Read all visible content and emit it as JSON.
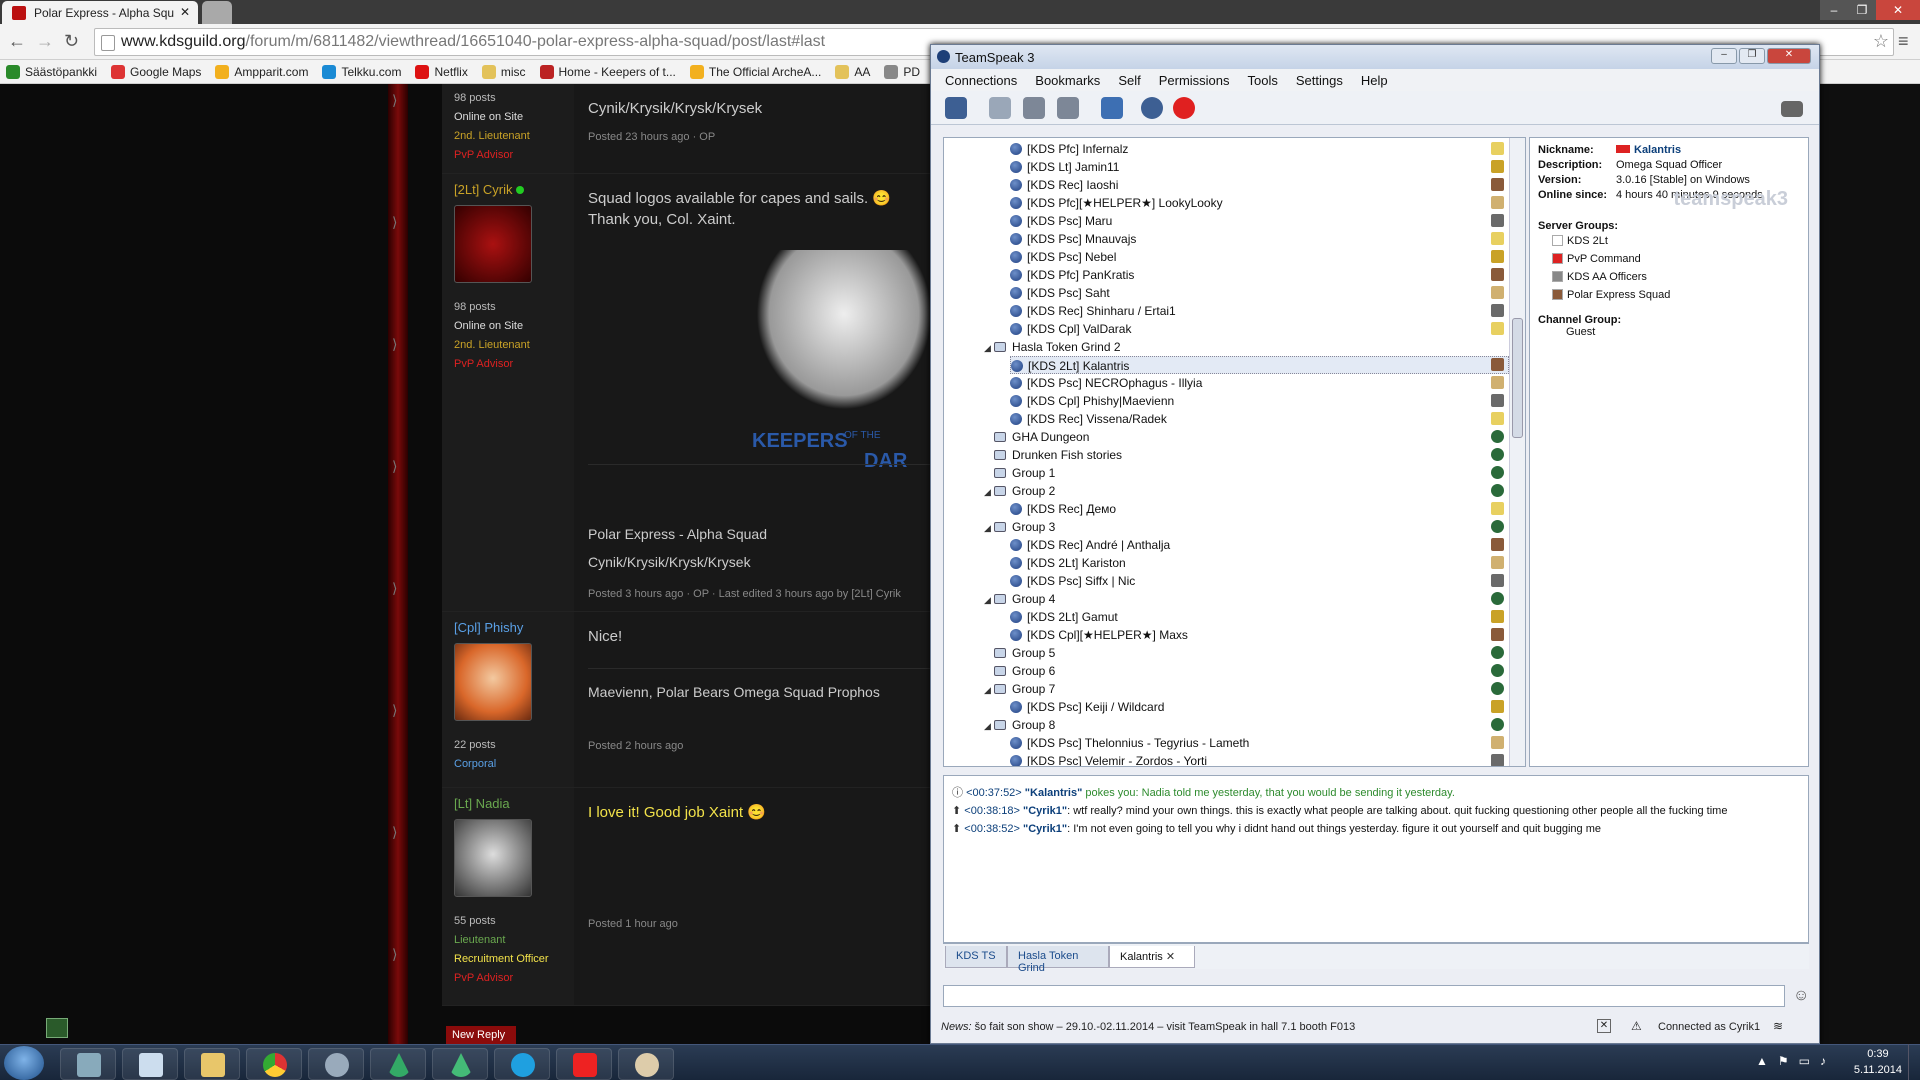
{
  "browser": {
    "tab_title": "Polar Express - Alpha Squ",
    "url_host": "www.kdsguild.org",
    "url_path": "/forum/m/6811482/viewthread/16651040-polar-express-alpha-squad/post/last#last",
    "bookmarks": [
      "Säästöpankki",
      "Google Maps",
      "Ampparit.com",
      "Telkku.com",
      "Netflix",
      "misc",
      "Home - Keepers of t...",
      "The Official ArcheA...",
      "AA",
      "PD"
    ]
  },
  "forum": {
    "post0": {
      "posts": "98 posts",
      "status": "Online on Site",
      "rank": "2nd. Lieutenant",
      "role": "PvP Advisor",
      "text": "Cynik/Krysik/Krysk/Krysek",
      "meta": "Posted 23 hours ago · OP"
    },
    "post1": {
      "name": "[2Lt] Cyrik",
      "posts": "98 posts",
      "status": "Online on Site",
      "rank": "2nd. Lieutenant",
      "role": "PvP Advisor",
      "text1": "Squad logos available for capes and sails. 😊",
      "text2": "Thank you, Col. Xaint.",
      "logo_text1": "KEEPERS",
      "logo_text2": "OF THE",
      "logo_text3": "DAR",
      "text3": "Polar Express - Alpha Squad",
      "text4": "Cynik/Krysik/Krysk/Krysek",
      "meta": "Posted 3 hours ago · OP · Last edited 3 hours ago by [2Lt] Cyrik"
    },
    "post2": {
      "name": "[Cpl] Phishy",
      "posts": "22 posts",
      "rank": "Corporal",
      "text1": "Nice!",
      "text2": "Maevienn, Polar Bears Omega Squad Prophos",
      "meta": "Posted 2 hours ago"
    },
    "post3": {
      "name": "[Lt] Nadia",
      "posts": "55 posts",
      "rank": "Lieutenant",
      "role1": "Recruitment Officer",
      "role2": "PvP Advisor",
      "text": "I love it! Good job Xaint 😊",
      "meta": "Posted 1 hour ago"
    },
    "new_reply": "New Reply"
  },
  "ts": {
    "title": "TeamSpeak 3",
    "menu": [
      "Connections",
      "Bookmarks",
      "Self",
      "Permissions",
      "Tools",
      "Settings",
      "Help"
    ],
    "tree": [
      {
        "t": "u",
        "d": 1,
        "label": "[KDS Pfc] Infernalz"
      },
      {
        "t": "u",
        "d": 1,
        "label": "[KDS Lt] Jamin11"
      },
      {
        "t": "u",
        "d": 1,
        "label": "[KDS Rec] Iaoshi"
      },
      {
        "t": "u",
        "d": 1,
        "label": "[KDS Pfc][★HELPER★] LookyLooky"
      },
      {
        "t": "u",
        "d": 1,
        "label": "[KDS Psc] Maru"
      },
      {
        "t": "u",
        "d": 1,
        "label": "[KDS Psc] Mnauvajs"
      },
      {
        "t": "u",
        "d": 1,
        "label": "[KDS Psc] Nebel"
      },
      {
        "t": "u",
        "d": 1,
        "label": "[KDS Pfc] PanKratis"
      },
      {
        "t": "u",
        "d": 1,
        "label": "[KDS Psc] Saht"
      },
      {
        "t": "u",
        "d": 1,
        "label": "[KDS Rec] Shinharu / Ertai1"
      },
      {
        "t": "u",
        "d": 1,
        "label": "[KDS Cpl] ValDarak"
      },
      {
        "t": "c",
        "d": 0,
        "label": "Hasla Token Grind 2",
        "open": true
      },
      {
        "t": "u",
        "d": 1,
        "label": "[KDS 2Lt] Kalantris",
        "sel": true
      },
      {
        "t": "u",
        "d": 1,
        "label": "[KDS Psc] NECROphagus - Illyia"
      },
      {
        "t": "u",
        "d": 1,
        "label": "[KDS Cpl] Phishy|Maevienn"
      },
      {
        "t": "u",
        "d": 1,
        "label": "[KDS Rec] Vissena/Radek"
      },
      {
        "t": "c",
        "d": 0,
        "label": "GHA Dungeon"
      },
      {
        "t": "c",
        "d": 0,
        "label": "Drunken Fish stories"
      },
      {
        "t": "c",
        "d": 0,
        "label": "Group 1"
      },
      {
        "t": "c",
        "d": 0,
        "label": "Group 2",
        "open": true
      },
      {
        "t": "u",
        "d": 1,
        "label": "[KDS Rec] Демо"
      },
      {
        "t": "c",
        "d": 0,
        "label": "Group 3",
        "open": true
      },
      {
        "t": "u",
        "d": 1,
        "label": "[KDS Rec] André | Anthalja"
      },
      {
        "t": "u",
        "d": 1,
        "label": "[KDS 2Lt] Kariston"
      },
      {
        "t": "u",
        "d": 1,
        "label": "[KDS Psc] Siffx | Nic"
      },
      {
        "t": "c",
        "d": 0,
        "label": "Group 4",
        "open": true
      },
      {
        "t": "u",
        "d": 1,
        "label": "[KDS 2Lt] Gamut"
      },
      {
        "t": "u",
        "d": 1,
        "label": "[KDS Cpl][★HELPER★] Maxs"
      },
      {
        "t": "c",
        "d": 0,
        "label": "Group 5"
      },
      {
        "t": "c",
        "d": 0,
        "label": "Group 6"
      },
      {
        "t": "c",
        "d": 0,
        "label": "Group 7",
        "open": true
      },
      {
        "t": "u",
        "d": 1,
        "label": "[KDS Psc] Keiji / Wildcard"
      },
      {
        "t": "c",
        "d": 0,
        "label": "Group 8",
        "open": true
      },
      {
        "t": "u",
        "d": 1,
        "label": "[KDS Psc] Thelonnius - Tegyrius - Lameth"
      },
      {
        "t": "u",
        "d": 1,
        "label": "[KDS Psc] Velemir - Zordos - Yorti"
      }
    ],
    "info": {
      "nickname_label": "Nickname:",
      "nickname": "Kalantris",
      "description_label": "Description:",
      "description": "Omega Squad Officer",
      "version_label": "Version:",
      "version": "3.0.16 [Stable] on Windows",
      "online_label": "Online since:",
      "online": "4 hours 40 minutes 9 seconds",
      "server_groups_label": "Server Groups:",
      "server_groups": [
        "KDS 2Lt",
        "PvP Command",
        "KDS AA Officers",
        "Polar Express Squad"
      ],
      "channel_group_label": "Channel Group:",
      "channel_group": "Guest",
      "watermark": "teamspeak3"
    },
    "chat": [
      {
        "time": "<00:37:52>",
        "name": "\"Kalantris\"",
        "msg": " pokes you: Nadia told me yesterday, that you would be sending it yesterday.",
        "color": "#2e8b2e"
      },
      {
        "time": "<00:38:18>",
        "name": "\"Cyrik1\"",
        "msg": ": wtf really? mind your own things. this is exactly what people are talking about. quit fucking questioning other people all the fucking time",
        "color": "#111111"
      },
      {
        "time": "<00:38:52>",
        "name": "\"Cyrik1\"",
        "msg": ": I'm not even going to tell you why i didnt hand out things yesterday. figure it out yourself and quit bugging me",
        "color": "#111111"
      }
    ],
    "tabs": [
      "KDS TS",
      "Hasla Token Grind",
      "Kalantris"
    ],
    "news_label": "News:",
    "news": "šo fait son show – 29.10.-02.11.2014 – visit TeamSpeak in hall 7.1 booth F013",
    "connected": "Connected as Cyrik1"
  },
  "taskbar": {
    "time": "0:39",
    "date": "5.11.2014"
  }
}
